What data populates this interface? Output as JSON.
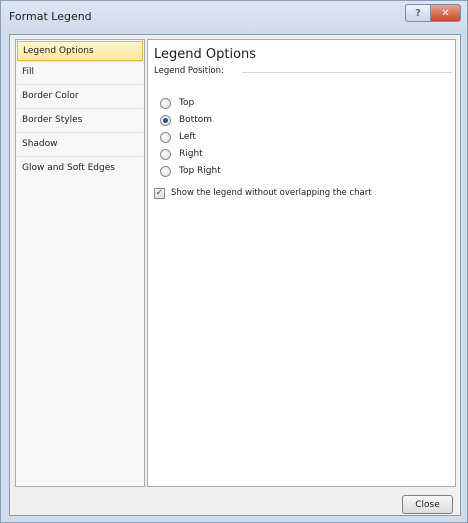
{
  "window": {
    "title": "Format Legend",
    "help_button": "?",
    "close_button": "✕"
  },
  "nav": {
    "items": [
      {
        "label": "Legend Options",
        "selected": true
      },
      {
        "label": "Fill",
        "selected": false
      },
      {
        "label": "Border Color",
        "selected": false
      },
      {
        "label": "Border Styles",
        "selected": false
      },
      {
        "label": "Shadow",
        "selected": false
      },
      {
        "label": "Glow and Soft Edges",
        "selected": false
      }
    ]
  },
  "content": {
    "title": "Legend Options",
    "group_label": "Legend Position:",
    "positions": [
      {
        "label": "Top",
        "checked": false
      },
      {
        "label": "Bottom",
        "checked": true
      },
      {
        "label": "Left",
        "checked": false
      },
      {
        "label": "Right",
        "checked": false
      },
      {
        "label": "Top Right",
        "checked": false
      }
    ],
    "overlap_checkbox": {
      "label": "Show the legend without overlapping the chart",
      "checked": true
    }
  },
  "footer": {
    "close_label": "Close"
  },
  "colors": {
    "selected_bg": "#ffe79b",
    "selected_border": "#e3b84b",
    "radio_dot": "#2a4f8a"
  },
  "icons": {
    "help": "help-icon",
    "close": "close-icon"
  }
}
